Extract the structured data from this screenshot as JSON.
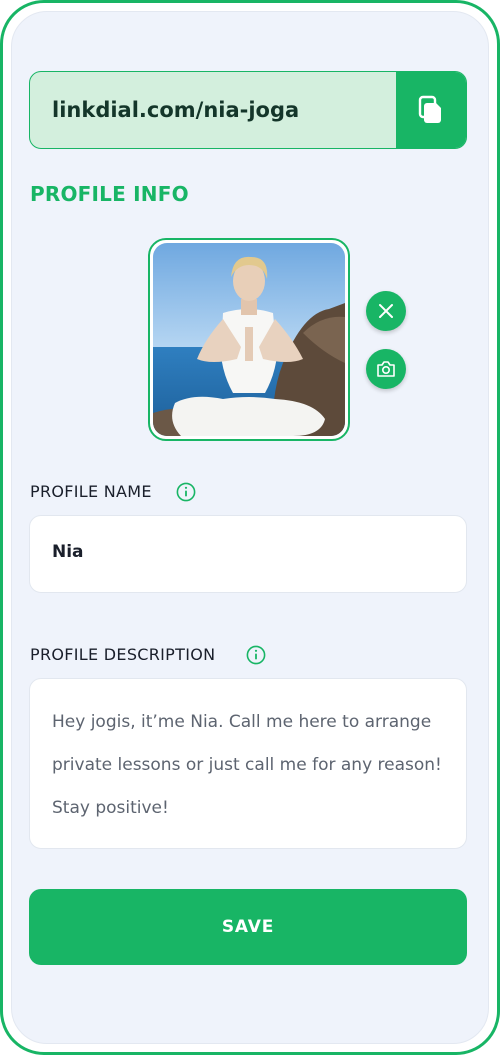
{
  "link": {
    "url": "linkdial.com/nia-joga",
    "copy_icon": "copy-icon"
  },
  "profile": {
    "section_title": "PROFILE INFO",
    "photo_alt": "Profile photo",
    "remove_icon": "close-icon",
    "camera_icon": "camera-icon"
  },
  "name_field": {
    "label": "PROFILE NAME",
    "value": "Nia",
    "info_icon": "info-icon"
  },
  "description_field": {
    "label": "PROFILE DESCRIPTION",
    "value": "Hey jogis, it’me Nia. Call me here to arrange private lessons or just call me for any reason! Stay positive!",
    "info_icon": "info-icon"
  },
  "save_button": {
    "label": "SAVE"
  },
  "colors": {
    "accent": "#18b565",
    "accent_light": "#d3efdd",
    "background": "#eff3fb",
    "text": "#1a1f2b"
  }
}
